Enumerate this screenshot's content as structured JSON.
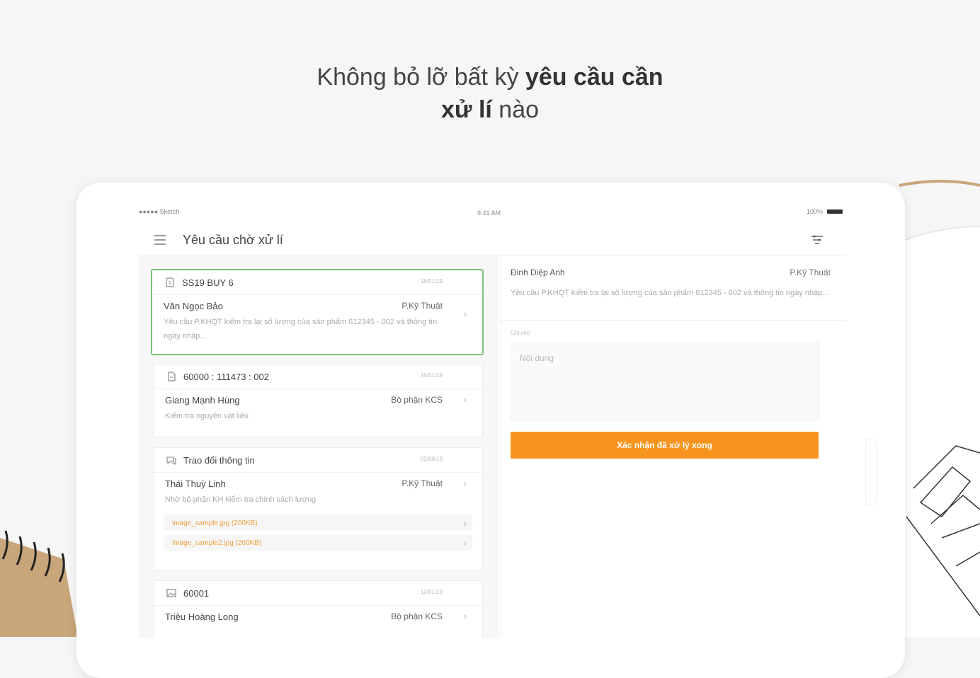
{
  "headline": {
    "part1": "Không bỏ lỡ bất kỳ ",
    "bold1": "yêu cầu cần",
    "bold2": "xử lí",
    "part2": " nào"
  },
  "status_bar": {
    "carrier": "●●●●● Sketch",
    "time": "9:41 AM",
    "battery": "100%"
  },
  "app_bar": {
    "title": "Yêu cầu chờ xử lí",
    "menu_icon": "hamburger-menu-icon",
    "filter_icon": "filter-icon"
  },
  "requests": [
    {
      "icon": "document-icon",
      "code": "SS19 BUY 6",
      "date": "16/01/19",
      "name": "Văn Ngọc Bảo",
      "dept": "P.Kỹ Thuật",
      "desc": "Yêu cầu P.KHQT kiểm tra lại số lượng của sản phẩm 612345 - 002 và thông tin ngày nhập..."
    },
    {
      "icon": "file-icon",
      "code": "60000 : 111473 : 002",
      "date": "16/01/19",
      "name": "Giang Mạnh Hùng",
      "dept": "Bộ phận KCS",
      "desc": "Kiểm tra nguyên vật liệu"
    },
    {
      "icon": "chat-icon",
      "code": "Trao đổi thông tin",
      "date": "02/08/19",
      "name": "Thái Thuỳ Linh",
      "dept": "P.Kỹ Thuật",
      "desc": "Nhờ bộ phận KH kiểm tra chính sách lương",
      "attachments": [
        "image_sample.jpg (200KB)",
        "image_sample2.jpg (200KB)"
      ]
    },
    {
      "icon": "image-icon",
      "code": "60001",
      "date": "12/01/19",
      "name": "Triệu Hoàng Long",
      "dept": "Bộ phận KCS"
    }
  ],
  "detail": {
    "name": "Đinh Diệp Anh",
    "dept": "P.Kỹ Thuật",
    "desc": "Yêu cầu P.KHQT kiểm tra lại số lượng của sản phẩm 612345 - 002 và thông tin ngày nhập...",
    "note_label": "Ghi chú",
    "note_placeholder": "Nội dung",
    "confirm_label": "Xác nhận đã xử lý xong"
  },
  "colors": {
    "accent": "#f7941d",
    "active_border": "#7ac27a",
    "attachment_text": "#f0a040"
  }
}
